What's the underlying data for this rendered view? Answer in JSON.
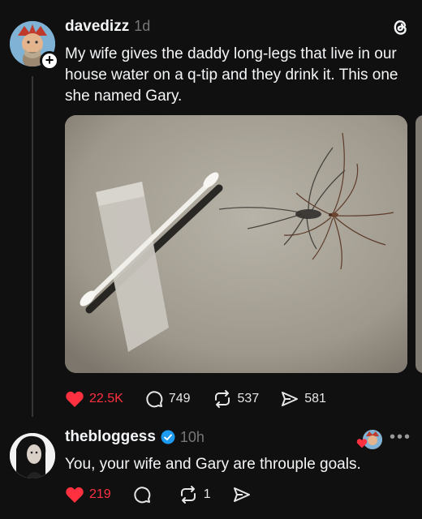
{
  "post": {
    "username": "davedizz",
    "time": "1d",
    "text": "My wife gives the daddy long-legs that live in our house water on a q-tip and they drink it. This one she named Gary.",
    "likes": "22.5K",
    "replies": "749",
    "reposts": "537",
    "shares": "581",
    "colors": {
      "like": "#ff3040",
      "text": "#f3f5f7",
      "muted": "#777777",
      "background": "#101010"
    }
  },
  "reply": {
    "username": "thebloggess",
    "time": "10h",
    "text": "You, your wife and Gary are throuple goals.",
    "likes": "219",
    "reposts": "1",
    "more": "•••",
    "verified_color": "#1d9bf0"
  },
  "icons": [
    "threads-logo-icon",
    "plus-icon",
    "heart-icon",
    "comment-icon",
    "repost-icon",
    "share-icon",
    "verified-icon",
    "more-icon"
  ]
}
